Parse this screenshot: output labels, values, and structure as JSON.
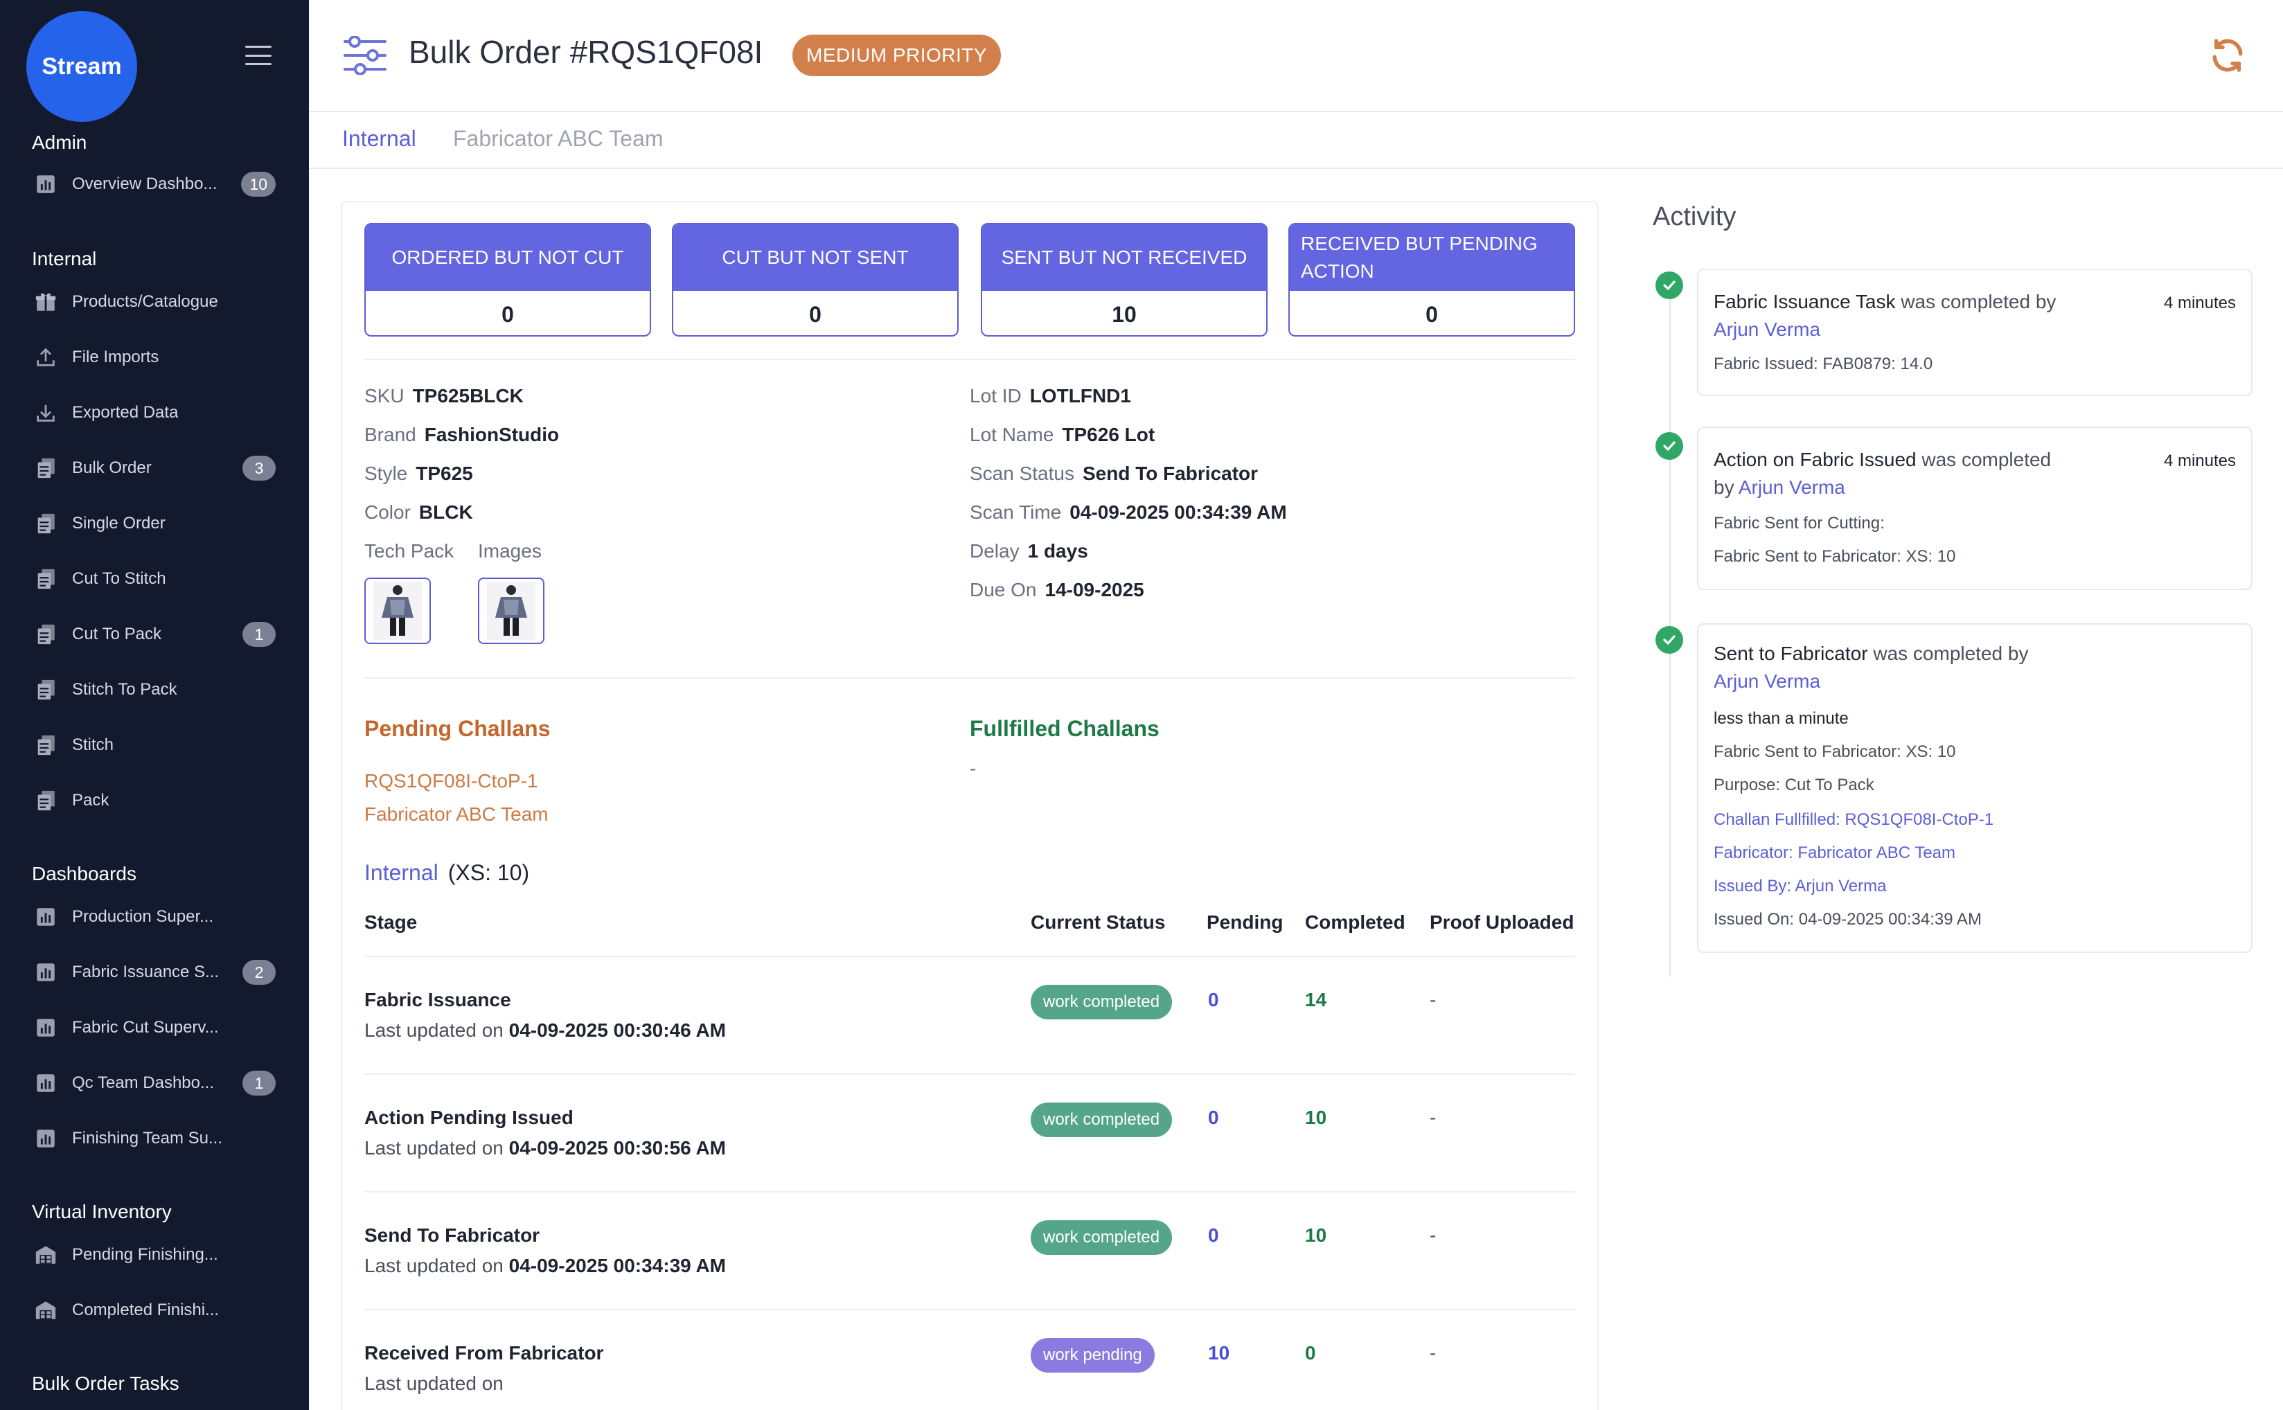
{
  "sidebar": {
    "logo": "Stream",
    "sections": {
      "admin": "Admin",
      "internal": "Internal",
      "dashboards": "Dashboards",
      "virtual_inventory": "Virtual Inventory",
      "bulk_order_tasks": "Bulk Order Tasks"
    },
    "items": {
      "overview": {
        "label": "Overview Dashbo...",
        "badge": "10"
      },
      "products": {
        "label": "Products/Catalogue"
      },
      "file_imports": {
        "label": "File Imports"
      },
      "exported": {
        "label": "Exported Data"
      },
      "bulk_order": {
        "label": "Bulk Order",
        "badge": "3"
      },
      "single_order": {
        "label": "Single Order"
      },
      "cut_to_stitch": {
        "label": "Cut To Stitch"
      },
      "cut_to_pack": {
        "label": "Cut To Pack",
        "badge": "1"
      },
      "stitch_to_pack": {
        "label": "Stitch To Pack"
      },
      "stitch": {
        "label": "Stitch"
      },
      "pack": {
        "label": "Pack"
      },
      "production_super": {
        "label": "Production Super..."
      },
      "fabric_issuance": {
        "label": "Fabric Issuance S...",
        "badge": "2"
      },
      "fabric_cut": {
        "label": "Fabric Cut Superv..."
      },
      "qc_team": {
        "label": "Qc Team Dashbo...",
        "badge": "1"
      },
      "finishing_team": {
        "label": "Finishing Team Su..."
      },
      "pending_finishing": {
        "label": "Pending Finishing..."
      },
      "completed_finishing": {
        "label": "Completed Finishi..."
      }
    }
  },
  "header": {
    "title": "Bulk Order #RQS1QF08I",
    "priority": "MEDIUM PRIORITY"
  },
  "tabs": {
    "internal": "Internal",
    "fabricator": "Fabricator ABC Team"
  },
  "stats": {
    "ordered_not_cut": {
      "label": "ORDERED BUT NOT CUT",
      "value": "0"
    },
    "cut_not_sent": {
      "label": "CUT BUT NOT SENT",
      "value": "0"
    },
    "sent_not_received": {
      "label": "SENT BUT NOT RECEIVED",
      "value": "10"
    },
    "received_pending": {
      "label": "RECEIVED BUT PENDING ACTION",
      "value": "0"
    }
  },
  "details": {
    "sku": {
      "label": "SKU",
      "value": "TP625BLCK"
    },
    "brand": {
      "label": "Brand",
      "value": "FashionStudio"
    },
    "style": {
      "label": "Style",
      "value": "TP625"
    },
    "color": {
      "label": "Color",
      "value": "BLCK"
    },
    "tech_pack": "Tech Pack",
    "images": "Images",
    "lot_id": {
      "label": "Lot ID",
      "value": "LOTLFND1"
    },
    "lot_name": {
      "label": "Lot Name",
      "value": "TP626 Lot"
    },
    "scan_status": {
      "label": "Scan Status",
      "value": "Send To Fabricator"
    },
    "scan_time": {
      "label": "Scan Time",
      "value": "04-09-2025 00:34:39 AM"
    },
    "delay": {
      "label": "Delay",
      "value": "1 days"
    },
    "due_on": {
      "label": "Due On",
      "value": "14-09-2025"
    }
  },
  "challans": {
    "pending_title": "Pending Challans",
    "pending_id": "RQS1QF08I-CtoP-1",
    "pending_team": "Fabricator ABC Team",
    "fulfilled_title": "Fullfilled Challans",
    "fulfilled_value": "-"
  },
  "internal_table": {
    "title": "Internal",
    "qty": "(XS: 10)",
    "headers": {
      "stage": "Stage",
      "status": "Current Status",
      "pending": "Pending",
      "completed": "Completed",
      "proof": "Proof Uploaded"
    },
    "updated_prefix": "Last updated on",
    "rows": [
      {
        "stage": "Fabric Issuance",
        "updated": "04-09-2025 00:30:46 AM",
        "status": "work completed",
        "pending": "0",
        "completed": "14",
        "proof": "-"
      },
      {
        "stage": "Action Pending Issued",
        "updated": "04-09-2025 00:30:56 AM",
        "status": "work completed",
        "pending": "0",
        "completed": "10",
        "proof": "-"
      },
      {
        "stage": "Send To Fabricator",
        "updated": "04-09-2025 00:34:39 AM",
        "status": "work completed",
        "pending": "0",
        "completed": "10",
        "proof": "-"
      },
      {
        "stage": "Received From Fabricator",
        "updated": "",
        "status": "work pending",
        "pending": "10",
        "completed": "0",
        "proof": "-"
      }
    ]
  },
  "activity": {
    "title": "Activity",
    "items": [
      {
        "task": "Fabric Issuance Task",
        "verb": "was completed by",
        "user": "Arjun Verma",
        "time": "4 minutes",
        "lines": [
          "Fabric Issued: FAB0879: 14.0"
        ]
      },
      {
        "task": "Action on Fabric Issued",
        "verb": "was completed",
        "by": "by",
        "user": "Arjun Verma",
        "time": "4 minutes",
        "lines": [
          "Fabric Sent for Cutting:",
          "Fabric Sent to Fabricator: XS: 10"
        ]
      },
      {
        "task": "Sent to Fabricator",
        "verb": "was completed by",
        "user": "Arjun Verma",
        "time": "less than a minute",
        "lines": [
          "Fabric Sent to Fabricator: XS: 10",
          "Purpose: Cut To Pack"
        ],
        "blue_lines": [
          "Challan Fullfilled: RQS1QF08I-CtoP-1",
          "Fabricator: Fabricator ABC Team",
          "Issued By: Arjun Verma"
        ],
        "issued_on": "Issued On: 04-09-2025 00:34:39 AM"
      }
    ]
  },
  "colors": {
    "sidebar_bg": "#141a2e",
    "accent": "#6366e0",
    "priority": "#d27f4c",
    "success": "#2fa866"
  }
}
